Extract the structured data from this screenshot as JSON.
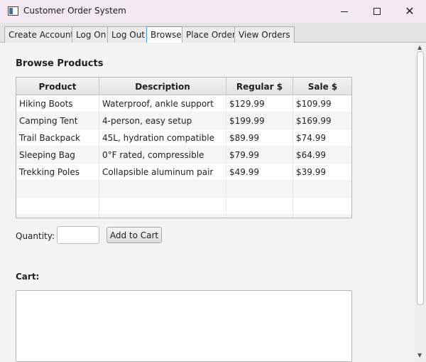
{
  "window": {
    "title": "Customer Order System",
    "minimize_icon": "minimize-icon",
    "maximize_icon": "maximize-icon",
    "close_icon": "close-icon",
    "close_glyph": "✕"
  },
  "tabs": [
    {
      "label": "Create Account"
    },
    {
      "label": "Log On"
    },
    {
      "label": "Log Out"
    },
    {
      "label": "Browse",
      "active": true
    },
    {
      "label": "Place Order"
    },
    {
      "label": "View Orders"
    }
  ],
  "browse": {
    "heading": "Browse Products",
    "columns": [
      "Product",
      "Description",
      "Regular $",
      "Sale $"
    ],
    "rows": [
      [
        "Hiking Boots",
        "Waterproof, ankle support",
        "$129.99",
        "$109.99"
      ],
      [
        "Camping Tent",
        "4-person, easy setup",
        "$199.99",
        "$169.99"
      ],
      [
        "Trail Backpack",
        "45L, hydration compatible",
        "$89.99",
        "$74.99"
      ],
      [
        "Sleeping Bag",
        "0°F rated, compressible",
        "$79.99",
        "$64.99"
      ],
      [
        "Trekking Poles",
        "Collapsible aluminum pair",
        "$49.99",
        "$39.99"
      ]
    ],
    "quantity_label": "Quantity:",
    "quantity_value": "",
    "add_button": "Add to Cart",
    "cart_label": "Cart:",
    "cart_contents": ""
  },
  "colors": {
    "titlebar": "#f3e9f3",
    "active_tab_border": "#4a9ee0"
  }
}
